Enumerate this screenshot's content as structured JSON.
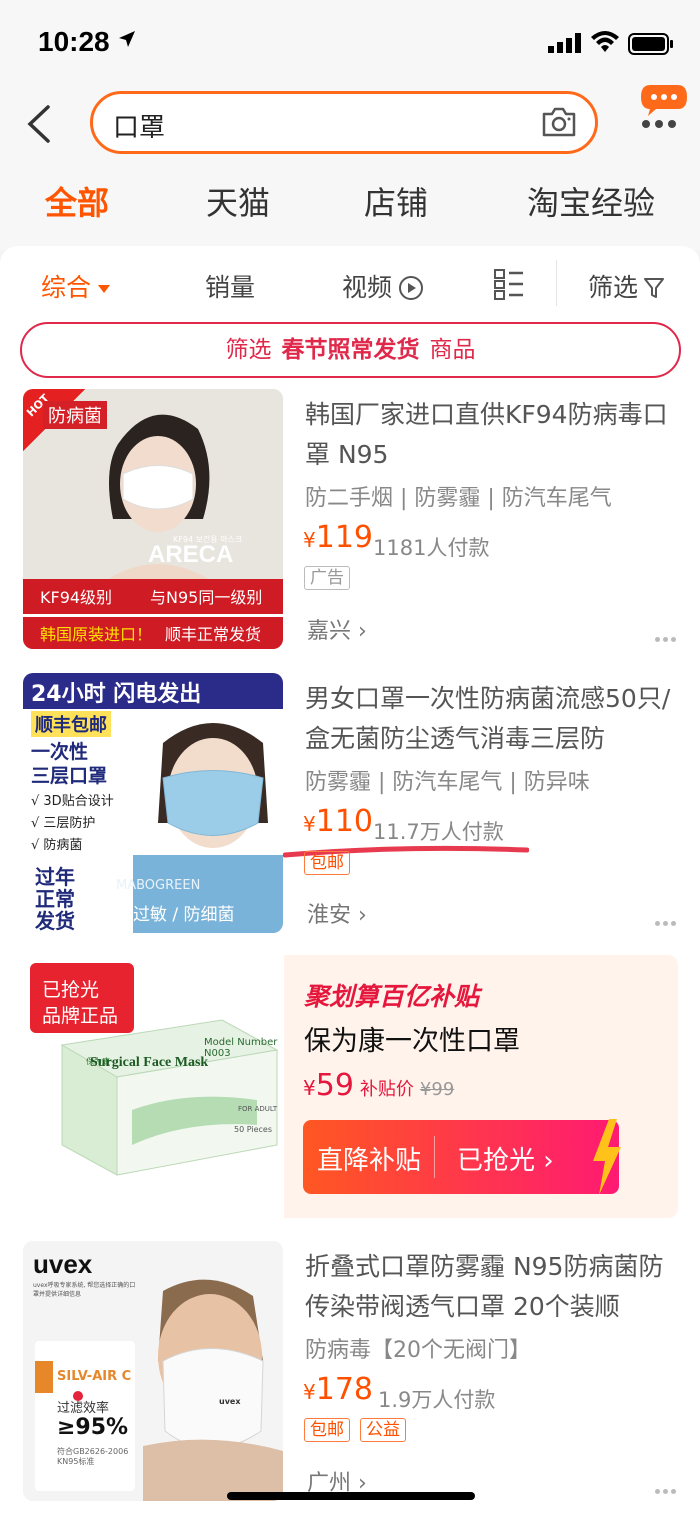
{
  "status": {
    "time": "10:28"
  },
  "search": {
    "query": "口罩"
  },
  "tabs": [
    "全部",
    "天猫",
    "店铺",
    "淘宝经验"
  ],
  "sort": [
    "综合",
    "销量",
    "视频",
    "筛选"
  ],
  "banner": {
    "pre": "筛选",
    "highlight": "春节照常发货",
    "post": "商品"
  },
  "items": [
    {
      "title": "韩国厂家进口直供KF94防病毒口罩 N95",
      "tags": "防二手烟 | 防雾霾 | 防汽车尾气",
      "price": "119",
      "sales": "1181人付款",
      "badges": [
        "广告"
      ],
      "city": "嘉兴",
      "img": {
        "hot": "HOT",
        "corner": "防病菌",
        "brand": "ARECA",
        "small": "KF94 보건용 마스크",
        "line1a": "KF94级别",
        "line1b": "与N95同一级别",
        "line2a": "韩国原装进口！",
        "line2b": "顺丰正常发货"
      }
    },
    {
      "title": "男女口罩一次性防病菌流感50只/盒无菌防尘透气消毒三层防",
      "tags": "防雾霾 | 防汽车尾气 | 防异味",
      "price": "110",
      "sales": "11.7万人付款",
      "badges": [
        "包邮"
      ],
      "city": "淮安",
      "img": {
        "top": "24小时  闪电发出",
        "sf": "顺丰包邮",
        "t1": "一次性",
        "t2": "三层口罩",
        "c1": "√ 3D贴合设计",
        "c2": "√ 三层防护",
        "c3": "√ 防病菌",
        "y1": "过年",
        "y2": "正常",
        "y3": "发货",
        "brand": "MABOGREEN",
        "bottom": "防过敏 / 防细菌"
      }
    },
    {
      "title": "折叠式口罩防雾霾 N95防病菌防传染带阀透气口罩 20个装顺",
      "tags": "防病毒【20个无阀门】",
      "price": "178",
      "sales": "1.9万人付款",
      "badges": [
        "包邮",
        "公益"
      ],
      "city": "广州",
      "img": {
        "brand": "uvex",
        "sub": "uvex呼吸专家系统, 帮您选择正确的口罩并提供详细信息",
        "model": "SILV-AIR C",
        "eff": "过滤效率",
        "pct": "≥95%",
        "std": "符合GB2626-2006 KN95标准",
        "mask": "uvex"
      }
    }
  ],
  "ju": {
    "head": "聚划算百亿补贴",
    "name": "保为康一次性口罩",
    "price": "59",
    "sub": "补贴价",
    "orig": "¥99",
    "btn_left": "直降补贴",
    "btn_right": "已抢光",
    "sold_out": "已抢光",
    "genuine": "品牌正品",
    "box_label": "Surgical Face Mask",
    "box_model": "Model Number N003",
    "box_brand": "保为康",
    "box_pieces": "50 Pieces",
    "box_adult": "FOR ADULT"
  },
  "colors": {
    "accent": "#ff5500",
    "red": "#e0284a"
  }
}
